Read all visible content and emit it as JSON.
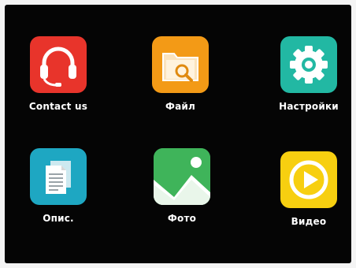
{
  "apps": [
    {
      "id": "contact",
      "label": "Contact us",
      "icon": "headset-icon",
      "color": "#e8342b"
    },
    {
      "id": "file",
      "label": "Файл",
      "icon": "folder-search-icon",
      "color": "#f39a16"
    },
    {
      "id": "settings",
      "label": "Настройки",
      "icon": "gear-icon",
      "color": "#22b8a3"
    },
    {
      "id": "desc",
      "label": "Опис.",
      "icon": "document-icon",
      "color": "#1ea7c2"
    },
    {
      "id": "photo",
      "label": "Фото",
      "icon": "photo-icon",
      "color": "#3fb45a"
    },
    {
      "id": "video",
      "label": "Видео",
      "icon": "play-icon",
      "color": "#f7cf10"
    }
  ]
}
